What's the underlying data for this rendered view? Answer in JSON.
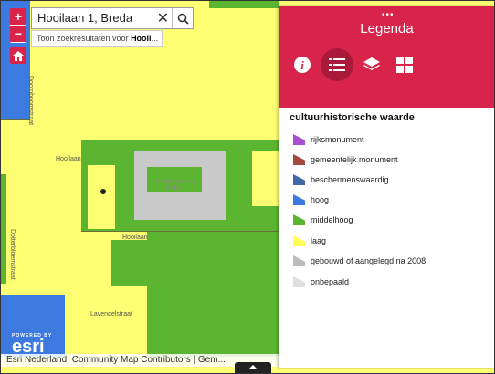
{
  "search": {
    "value": "Hooilaan 1, Breda",
    "suggest_prefix": "Toon zoekresultaten voor ",
    "suggest_bold": "Hooil",
    "suggest_suffix": "..."
  },
  "map": {
    "zoom_in": "+",
    "zoom_out": "−",
    "streets": [
      "Doornboomstraat",
      "Hooilaan",
      "Hooilaan",
      "Dotterbloemstraat",
      "Lavendelstraat"
    ],
    "school_label_1": "Kinderopvang",
    "school_label_2": "Nab...",
    "esri_powered": "POWERED BY",
    "esri_brand": "esri",
    "attribution": "Esri Nederland, Community Map Contributors | Gem..."
  },
  "legend": {
    "title": "Legenda",
    "dots": "•••",
    "section_title": "cultuurhistorische waarde",
    "items": [
      {
        "label": "rijksmonument",
        "color": "#a64fcf"
      },
      {
        "label": "gemeentelijk monument",
        "color": "#a5483e"
      },
      {
        "label": "beschermenswaardig",
        "color": "#4169a8"
      },
      {
        "label": "hoog",
        "color": "#3d7ae0"
      },
      {
        "label": "middelhoog",
        "color": "#5cb531"
      },
      {
        "label": "laag",
        "color": "#ffff55"
      },
      {
        "label": "gebouwd of aangelegd na 2008",
        "color": "#bdbdbd"
      },
      {
        "label": "onbepaald",
        "color": "#dedede"
      }
    ]
  },
  "colors": {
    "accent": "#d8244b",
    "accent_dark": "#a91a3a"
  },
  "icons": [
    "info-icon",
    "legend-list-icon",
    "layers-icon",
    "basemap-grid-icon",
    "search-icon",
    "home-icon",
    "clear-icon"
  ]
}
